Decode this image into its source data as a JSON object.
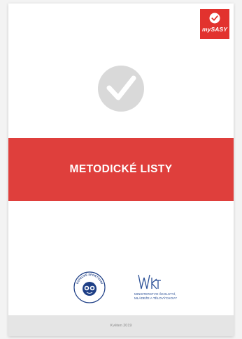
{
  "brand": {
    "name": "mySASY",
    "icon": "check-circle-icon",
    "color": "#e2322e"
  },
  "cover": {
    "emblem_icon": "check-circle-icon",
    "title": "METODICKÉ LISTY",
    "banner_color": "#df3f3c"
  },
  "partners": {
    "round_logo_text": "ÚSTECKÉ SPORTOVNÍ",
    "ministry_abbr": "MŠMT",
    "ministry_line1": "MINISTERSTVO ŠKOLSTVÍ,",
    "ministry_line2": "MLÁDEŽE A TĚLOVÝCHOVY"
  },
  "footer": {
    "date": "Květen 2019"
  }
}
